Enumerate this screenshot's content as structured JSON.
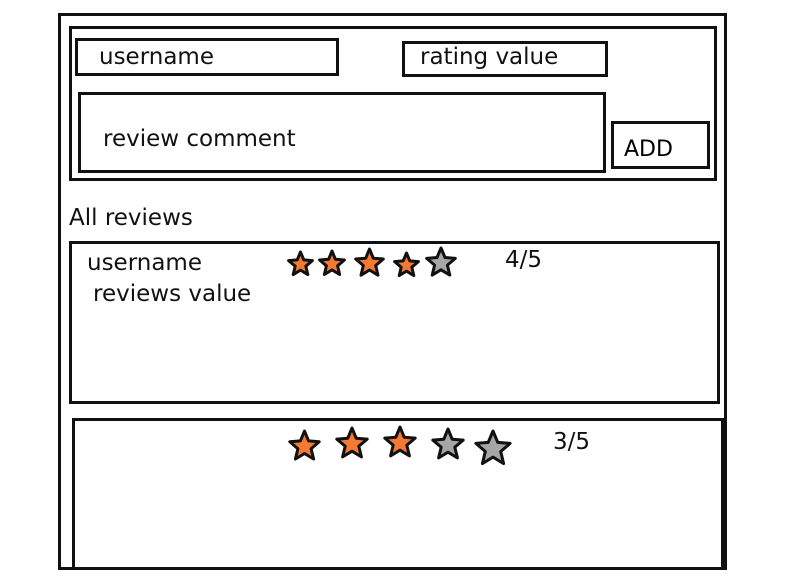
{
  "form": {
    "username_placeholder": "username",
    "rating_placeholder": "rating value",
    "comment_placeholder": "review comment",
    "add_label": "ADD"
  },
  "reviews_section": {
    "title": "All reviews",
    "reviews": [
      {
        "username": "username",
        "value": "reviews value",
        "rating": 4,
        "max": 5,
        "score_text": "4/5"
      },
      {
        "rating": 3,
        "max": 5,
        "score_text": "3/5"
      }
    ]
  },
  "colors": {
    "star_filled": "#f47a33",
    "star_empty": "#a6a6a6",
    "outline": "#111111"
  },
  "icons": [
    "star-filled-icon",
    "star-empty-icon"
  ]
}
